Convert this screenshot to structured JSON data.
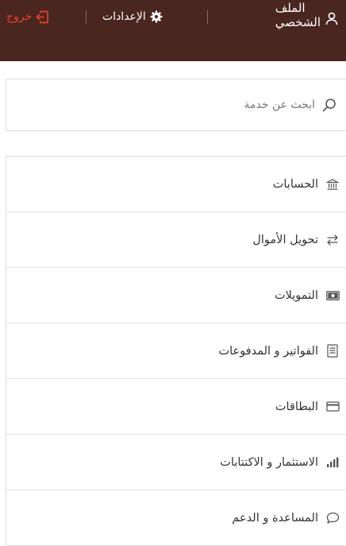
{
  "header": {
    "profile": {
      "line1": "الملف",
      "line2": "الشخصي",
      "icon": "user-icon"
    },
    "settings": {
      "label": "الإعدادات",
      "icon": "gear-icon"
    },
    "logout": {
      "label": "خروج",
      "icon": "logout-icon"
    }
  },
  "search": {
    "placeholder": "ابحث عن خدمة",
    "value": "",
    "icon": "search-icon"
  },
  "menu": {
    "items": [
      {
        "label": "الحسابات",
        "icon": "bank-icon"
      },
      {
        "label": "تحويل الأموال",
        "icon": "transfer-icon"
      },
      {
        "label": "التمويلات",
        "icon": "cash-icon"
      },
      {
        "label": "الفواتير و المدفوعات",
        "icon": "bill-icon"
      },
      {
        "label": "البطاقات",
        "icon": "card-icon"
      },
      {
        "label": "الاستثمار و الاكتتابات",
        "icon": "bar-chart-icon"
      },
      {
        "label": "المساعدة و الدعم",
        "icon": "chat-icon"
      }
    ]
  },
  "colors": {
    "header_bg": "#4a2620",
    "header_text": "#ffffff",
    "logout_accent": "#e3412a",
    "icon_color": "#555555"
  }
}
